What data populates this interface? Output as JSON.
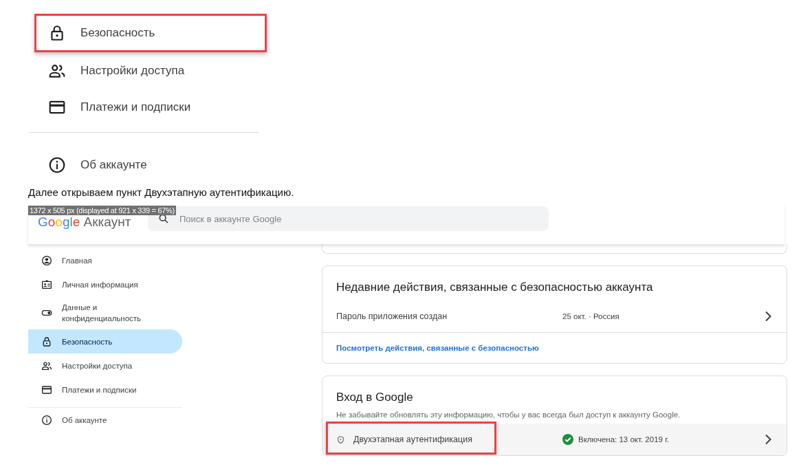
{
  "top_menu": {
    "groups": [
      [
        {
          "label": "Безопасность",
          "kind": "lock",
          "highlighted": true
        },
        {
          "label": "Настройки доступа",
          "kind": "people",
          "highlighted": false
        },
        {
          "label": "Платежи и подписки",
          "kind": "card",
          "highlighted": false
        }
      ],
      [
        {
          "label": "Об аккаунте",
          "kind": "info",
          "highlighted": false
        }
      ]
    ]
  },
  "paragraph": "Далее открываем пункт Двухэтапную аутентификацию.",
  "image_size_label": "1372 x 505 px (displayed at 921 x 339 = 67%)",
  "header": {
    "logo": "Google",
    "title": "Аккаунт",
    "search": {
      "placeholder": "Поиск в аккаунте Google"
    }
  },
  "sidebar": {
    "groups": [
      [
        {
          "label": "Главная",
          "kind": "account",
          "selected": false
        },
        {
          "label": "Личная информация",
          "kind": "id",
          "selected": false
        },
        {
          "label": "Данные и конфиденциальность",
          "kind": "toggle",
          "selected": false
        },
        {
          "label": "Безопасность",
          "kind": "lock",
          "selected": true
        },
        {
          "label": "Настройки доступа",
          "kind": "people",
          "selected": false
        },
        {
          "label": "Платежи и подписки",
          "kind": "card",
          "selected": false
        }
      ],
      [
        {
          "label": "Об аккаунте",
          "kind": "info",
          "selected": false
        }
      ]
    ]
  },
  "recent_activity": {
    "title": "Недавние действия, связанные с безопасностью аккаунта",
    "rows": [
      {
        "label": "Пароль приложения создан",
        "detail": "25 окт. · Россия"
      }
    ],
    "link": "Посмотреть действия, связанные с безопасностью"
  },
  "signin": {
    "title": "Вход в Google",
    "description": "Не забывайте обновлять эту информацию, чтобы у вас всегда был доступ к аккаунту Google.",
    "rows": [
      {
        "label": "Двухэтапная аутентификация",
        "kind": "shield",
        "status": "Включена: 13 окт. 2019 г.",
        "highlighted": true
      }
    ]
  }
}
